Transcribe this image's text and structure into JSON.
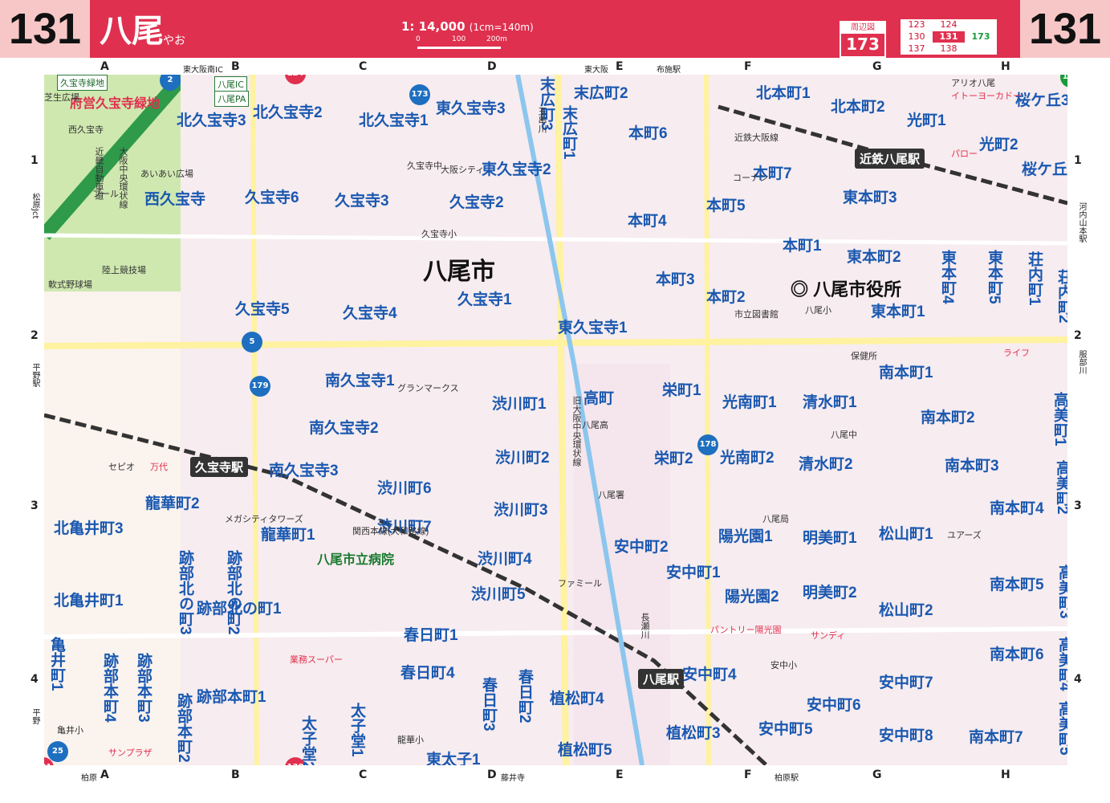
{
  "header": {
    "page_left": "131",
    "page_right": "131",
    "city": "八尾",
    "city_kana": "やお",
    "scale": "1: 14,000",
    "scale_unit": "(1cm=140m)",
    "scale_ticks": [
      "0",
      "100",
      "200m"
    ],
    "nearby_label": "周辺図",
    "nearby_page": "173",
    "grid_pages": [
      [
        "123",
        "124",
        ""
      ],
      [
        "130",
        "131",
        "173"
      ],
      [
        "137",
        "138",
        ""
      ]
    ]
  },
  "columns": [
    "A",
    "B",
    "C",
    "D",
    "E",
    "F",
    "G",
    "H"
  ],
  "rows": [
    "1",
    "2",
    "3",
    "4"
  ],
  "edge_labels": {
    "top": [
      "東大阪南IC",
      "東大阪",
      "布施駅"
    ],
    "bottom": [
      "柏原",
      "藤井寺",
      "柏原駅"
    ],
    "left": [
      "松原Jct",
      "平野駅",
      "平野"
    ],
    "right": [
      "河内山本駅",
      "服部川"
    ]
  },
  "route_shields": [
    {
      "num": "124",
      "color": "red"
    },
    {
      "num": "173",
      "color": "green"
    },
    {
      "num": "130",
      "color": "red"
    },
    {
      "num": "138",
      "color": "red"
    },
    {
      "num": "131",
      "color": "red"
    },
    {
      "num": "2",
      "color": "blue"
    },
    {
      "num": "5",
      "color": "blue"
    },
    {
      "num": "25",
      "color": "blue"
    },
    {
      "num": "179",
      "color": "blue"
    },
    {
      "num": "178",
      "color": "blue"
    },
    {
      "num": "173",
      "color": "blue"
    }
  ],
  "city_hall": "八尾市役所",
  "city_name": "八尾市",
  "towns": [
    "北久宝寺2",
    "北久宝寺3",
    "北久宝寺1",
    "西久宝寺",
    "久宝寺6",
    "久宝寺3",
    "久宝寺2",
    "東久宝寺3",
    "東久宝寺2",
    "久宝寺5",
    "久宝寺4",
    "久宝寺1",
    "東久宝寺1",
    "南久宝寺1",
    "南久宝寺2",
    "南久宝寺3",
    "末広町2",
    "本町6",
    "本町7",
    "本町5",
    "本町4",
    "本町3",
    "本町2",
    "本町1",
    "北本町1",
    "北本町2",
    "光町1",
    "光町2",
    "桜ケ丘3",
    "桜ケ丘1",
    "東本町3",
    "東本町2",
    "東本町1",
    "東本町4",
    "東本町5",
    "荘内町1",
    "荘内町2",
    "渋川町1",
    "渋川町2",
    "渋川町3",
    "渋川町4",
    "渋川町5",
    "渋川町6",
    "渋川町7",
    "高町",
    "栄町1",
    "栄町2",
    "光南町1",
    "光南町2",
    "清水町1",
    "清水町2",
    "南本町1",
    "南本町2",
    "南本町3",
    "南本町4",
    "南本町5",
    "南本町6",
    "南本町7",
    "明美町1",
    "明美町2",
    "松山町1",
    "松山町2",
    "陽光園1",
    "陽光園2",
    "安中町1",
    "安中町2",
    "安中町4",
    "安中町5",
    "安中町6",
    "安中町7",
    "安中町8",
    "植松町4",
    "植松町5",
    "植松町3",
    "北亀井町3",
    "北亀井町1",
    "亀井町1",
    "跡部北の町1",
    "跡部北の町2",
    "跡部北の町3",
    "跡部本町1",
    "跡部本町2",
    "跡部本町3",
    "跡部本町4",
    "龍華町1",
    "龍華町2",
    "春日町1",
    "春日町2",
    "春日町3",
    "春日町4",
    "太子堂1",
    "太子堂2",
    "東太子1",
    "高美町1",
    "高美町2",
    "高美町3",
    "高美町4",
    "高美町5",
    "末広町1",
    "末広町3"
  ],
  "stations": [
    "近鉄八尾駅",
    "久宝寺駅",
    "八尾駅",
    "JR八尾駅"
  ],
  "pois": [
    "久宝寺緑地",
    "府営久宝寺緑地",
    "大阪中央環状線",
    "近畿自動車道",
    "芝生広場",
    "西久宝寺",
    "あいあい広場",
    "プール",
    "陸上競技場",
    "軟式野球場",
    "八尾IC",
    "八尾PA",
    "久宝寺中",
    "久宝寺小",
    "八尾小",
    "八尾中",
    "八尾高",
    "八尾署",
    "保健所",
    "八尾局",
    "安中小",
    "亀井小",
    "龍華小",
    "八尾市立病院",
    "市立図書館",
    "アリオ八尾",
    "イトーヨーカドー",
    "パロー",
    "ライフ",
    "サンディ",
    "サンプラザ",
    "業務スーパー",
    "パントリー陽光園",
    "万代",
    "セピオ",
    "メガシティタワーズ",
    "関西本線(大和路線)",
    "近鉄大阪線",
    "旧大阪中央環状線",
    "長瀬川",
    "玉串川",
    "グランマークス",
    "大阪シティ",
    "ファミール",
    "コーナン",
    "ユアーズ"
  ]
}
